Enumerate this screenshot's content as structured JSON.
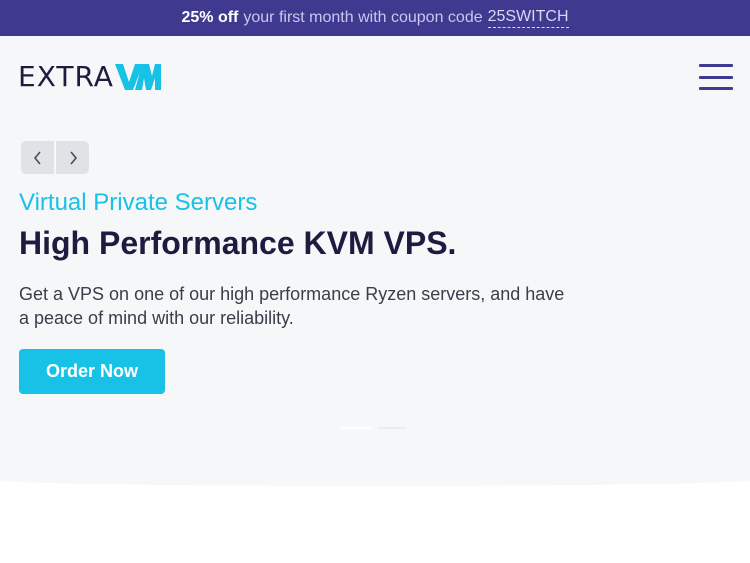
{
  "promo": {
    "discount": "25% off",
    "text": "your first month with coupon code",
    "code": "25SWITCH"
  },
  "brand": {
    "name_text": "EXTRA",
    "logo_mark_letters": "VM",
    "text_color": "#1c1c40",
    "accent_color": "#17c2e6"
  },
  "nav": {
    "menu_icon": "hamburger-menu-icon"
  },
  "carousel": {
    "prev_icon": "chevron-left-icon",
    "next_icon": "chevron-right-icon",
    "active_slide": 1,
    "slide_count": 2
  },
  "hero": {
    "subtitle": "Virtual Private Servers",
    "headline": "High Performance KVM VPS.",
    "description": "Get a VPS on one of our high performance Ryzen servers, and have a peace of mind with our reliability.",
    "cta_label": "Order Now"
  },
  "colors": {
    "promo_background": "#3f3a8f",
    "accent": "#17c2e6",
    "heading": "#1c1c40",
    "hero_background": "#f6f7f8"
  }
}
